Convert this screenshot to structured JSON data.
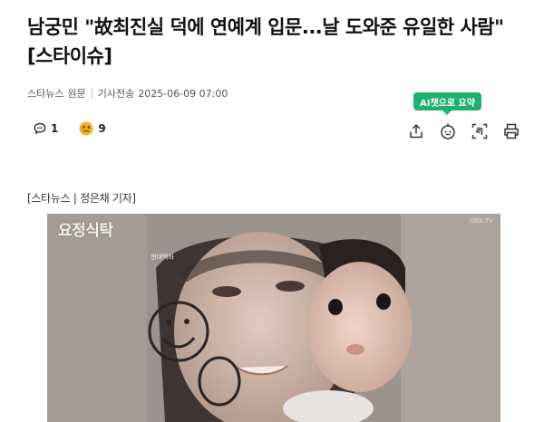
{
  "article": {
    "title": "남궁민 \"故최진실 덕에 연예계 입문...날 도와준 유일한 사람\"[스타이슈]",
    "source": "스타뉴스",
    "origin_label": "원문",
    "sent_label": "기사전송",
    "timestamp": "2025-06-09 07:00",
    "byline": "[스타뉴스 | 정은채 기자]"
  },
  "reactions": {
    "comment_count": "1",
    "emoji_count": "9"
  },
  "toolbar": {
    "ai_summary_label": "AI챗으로 요약",
    "icons": [
      "share-icon",
      "ai-bot-icon",
      "font-size-icon",
      "print-icon"
    ]
  },
  "photo": {
    "watermark": "요정식탁",
    "corner_mark": "OBS TV",
    "sub_logo": "현대백화"
  },
  "colors": {
    "ai_badge": "#20b06f",
    "emoji_yellow": "#f2b01e"
  }
}
